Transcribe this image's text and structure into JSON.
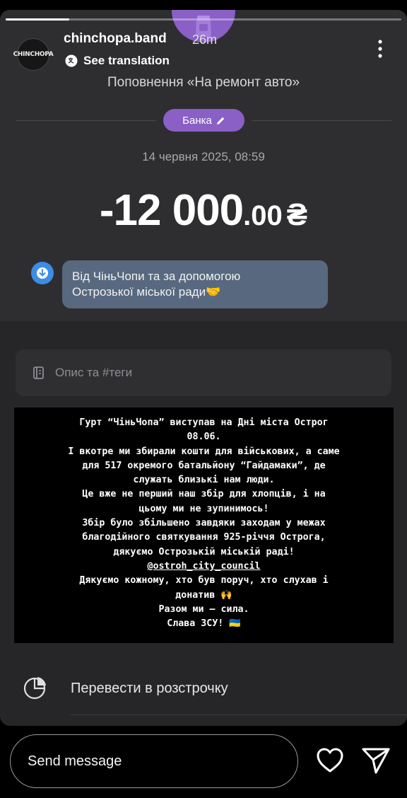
{
  "story": {
    "progress_fraction": 0.16,
    "username": "chinchopa.band",
    "time_ago": "26m",
    "avatar_text": "CHINCHOPA",
    "see_translation": "See translation"
  },
  "payment": {
    "title": "Поповнення «На ремонт авто»",
    "jar_label": "Банка",
    "date": "14 червня 2025, 08:59",
    "amount_main": "-12 000",
    "amount_cents": ".00",
    "currency": "₴",
    "comment_line1": "Від ЧіньЧопи та за допомогою",
    "comment_line2": "Острозької міської ради🤝",
    "description_placeholder": "Опис та #теги",
    "installment_label": "Перевести в розстрочку"
  },
  "overlay": {
    "lines": [
      "Гурт “ЧіньЧопа” виступав на Дні міста Острог",
      "08.06.",
      "І вкотре ми збирали кошти для військових, а саме",
      "для 517 окремого батальйону “Гайдамаки”, де",
      "служать близькі нам люди.",
      "Це вже не перший наш збір для хлопців, і на",
      "цьому ми не зупинимось!",
      "Збір було збільшено завдяки заходам у межах",
      "благодійного святкування 925-річчя Острога,",
      "дякуємо Острозькій міській раді!",
      "@ostroh_city_council",
      "Дякуємо кожному, хто був поруч, хто слухав і",
      "донатив 🙌",
      "Разом ми — сила.",
      "Слава ЗСУ! 🇺🇦"
    ]
  },
  "bottom": {
    "send_message_placeholder": "Send message"
  },
  "colors": {
    "accent_purple": "#8a5fc6",
    "comment_blue": "#3d8ce6",
    "bubble": "#58687f"
  },
  "icons": [
    "more-vertical-icon",
    "translate-icon",
    "jar-icon",
    "pencil-icon",
    "arrow-down-icon",
    "notes-icon",
    "pie-chart-icon",
    "heart-icon",
    "send-icon"
  ]
}
